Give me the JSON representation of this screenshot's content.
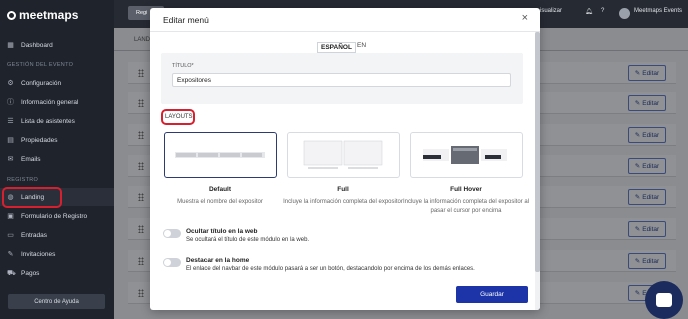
{
  "app": {
    "brand": "meetmaps"
  },
  "sidebar": {
    "items": [
      {
        "label": "Dashboard",
        "icon": "dashboard-icon"
      },
      {
        "label": "Configuración",
        "icon": "gear-icon"
      },
      {
        "label": "Información general",
        "icon": "info-icon"
      },
      {
        "label": "Lista de asistentes",
        "icon": "list-icon"
      },
      {
        "label": "Propiedades",
        "icon": "properties-icon"
      },
      {
        "label": "Emails",
        "icon": "email-icon"
      },
      {
        "label": "Landing",
        "icon": "globe-icon",
        "active": true
      },
      {
        "label": "Formulario de Registro",
        "icon": "form-icon"
      },
      {
        "label": "Entradas",
        "icon": "ticket-icon"
      },
      {
        "label": "Invitaciones",
        "icon": "invite-icon"
      },
      {
        "label": "Pagos",
        "icon": "cart-icon"
      }
    ],
    "section_event": "GESTIÓN DEL EVENTO",
    "section_registro": "REGISTRO",
    "help_button": "Centro de Ayuda"
  },
  "topbar": {
    "button": "Regi",
    "right_link": "isualizar",
    "user": "Meetmaps Events"
  },
  "content": {
    "tab": "LAND",
    "edit_label": "Editar",
    "rows": 8
  },
  "modal": {
    "title": "Editar menú",
    "close": "×",
    "lang_tabs": [
      "ESPAÑOL",
      "EN"
    ],
    "title_label": "TÍTULO*",
    "title_value": "Expositores",
    "layouts_label": "LAYOUTS",
    "layouts": [
      {
        "name": "Default",
        "description": "Muestra el nombre del expositor",
        "selected": true
      },
      {
        "name": "Full",
        "description": "Incluye la información completa del expositor",
        "selected": false
      },
      {
        "name": "Full Hover",
        "description": "Incluye la información completa del expositor al pasar el cursor por encima",
        "selected": false
      }
    ],
    "toggles": [
      {
        "title": "Ocultar título en la web",
        "description": "Se ocultará el título de este módulo en la web.",
        "on": false
      },
      {
        "title": "Destacar en la home",
        "description": "El enlace del navbar de este módulo pasará a ser un botón, destacandolo por encima de los demás enlaces.",
        "on": false
      }
    ],
    "save_button": "Guardar"
  },
  "colors": {
    "primary": "#1c34a8",
    "highlight": "#d6202f",
    "sidebar": "#1f232b"
  }
}
